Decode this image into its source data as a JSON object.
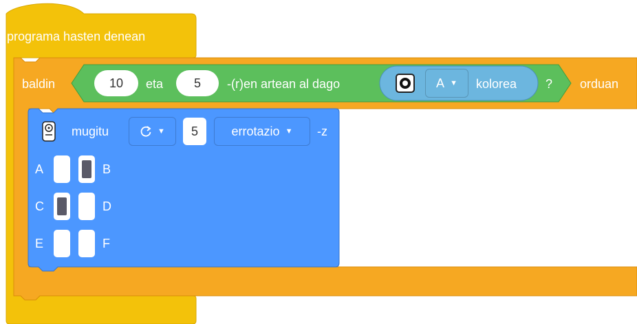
{
  "hat_block": {
    "label": "programa hasten denean",
    "color": "#f3c20a"
  },
  "if_block": {
    "label_if": "baldin",
    "label_then": "orduan",
    "color": "#f6a822",
    "condition": {
      "color": "#5cbf5c",
      "value1": "10",
      "and_label": "eta",
      "value2": "5",
      "between_label": "-(r)en artean al dago",
      "color_sensor": {
        "color": "#6cb6df",
        "port": "A",
        "suffix": "kolorea",
        "icon": "color-sensor-icon"
      },
      "question_mark": "?"
    }
  },
  "motor_block": {
    "color": "#4c97ff",
    "icon": "motor-icon",
    "label": "mugitu",
    "direction_icon": "rotate-clockwise-icon",
    "amount": "5",
    "unit": "errotazio",
    "suffix": "-z",
    "ports": [
      {
        "name": "A",
        "selected": false
      },
      {
        "name": "B",
        "selected": true
      },
      {
        "name": "C",
        "selected": true
      },
      {
        "name": "D",
        "selected": false
      },
      {
        "name": "E",
        "selected": false
      },
      {
        "name": "F",
        "selected": false
      }
    ]
  }
}
